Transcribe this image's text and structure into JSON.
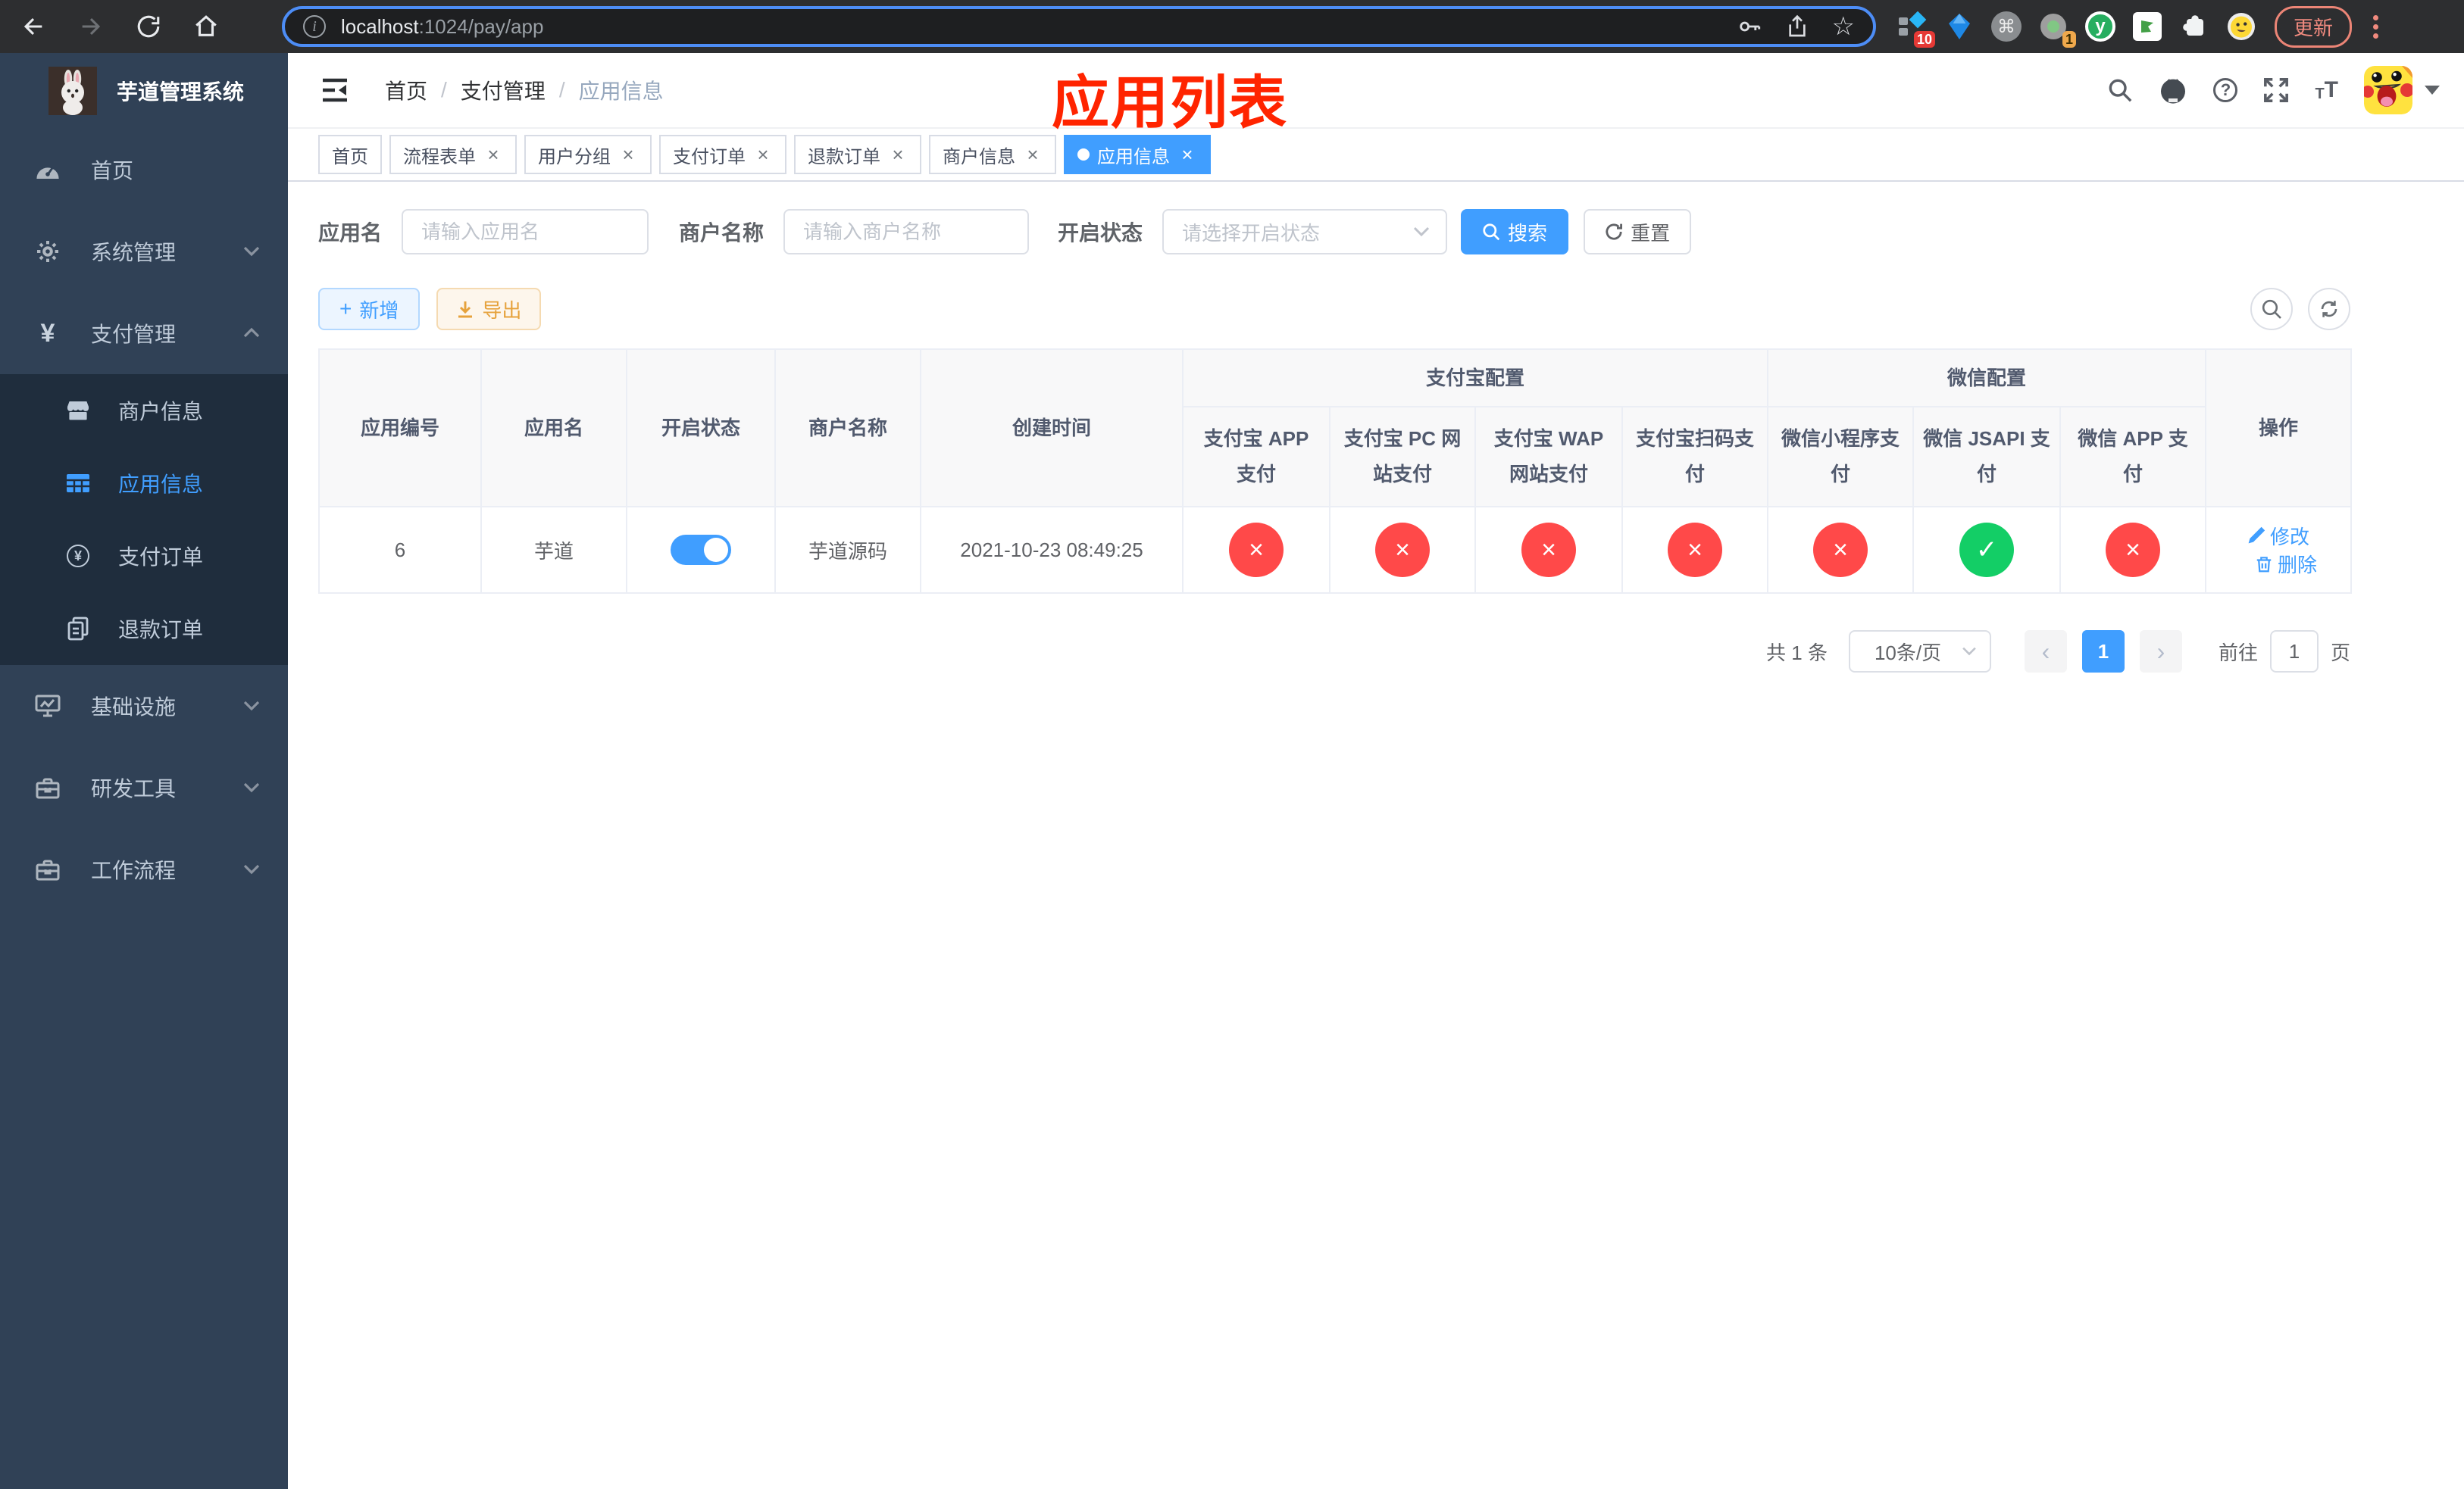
{
  "browser": {
    "url": {
      "host": "localhost",
      "path": ":1024/pay/app"
    },
    "update_label": "更新",
    "ext_badge_10": "10",
    "ext_badge_1": "1"
  },
  "glyphs": {
    "yen": "¥",
    "plus": "+",
    "star": "☆",
    "cmd": "⌘",
    "y_logo": "y",
    "question": "?",
    "info": "i",
    "prev": "‹",
    "next": "›",
    "check": "✓",
    "cross": "×",
    "t": "T"
  },
  "sidebar": {
    "logo_title": "芋道管理系统",
    "menu": [
      {
        "label": "首页"
      },
      {
        "label": "系统管理"
      },
      {
        "label": "支付管理"
      },
      {
        "label": "商户信息"
      },
      {
        "label": "应用信息"
      },
      {
        "label": "支付订单"
      },
      {
        "label": "退款订单"
      },
      {
        "label": "基础设施"
      },
      {
        "label": "研发工具"
      },
      {
        "label": "工作流程"
      }
    ]
  },
  "navbar": {
    "breadcrumb": [
      "首页",
      "支付管理",
      "应用信息"
    ]
  },
  "annotation": "应用列表",
  "tabs": [
    {
      "label": "首页"
    },
    {
      "label": "流程表单"
    },
    {
      "label": "用户分组"
    },
    {
      "label": "支付订单"
    },
    {
      "label": "退款订单"
    },
    {
      "label": "商户信息"
    },
    {
      "label": "应用信息"
    }
  ],
  "filters": {
    "app_name_label": "应用名",
    "app_name_placeholder": "请输入应用名",
    "merchant_label": "商户名称",
    "merchant_placeholder": "请输入商户名称",
    "status_label": "开启状态",
    "status_placeholder": "请选择开启状态",
    "search_label": "搜索",
    "reset_label": "重置"
  },
  "toolbar": {
    "add_label": "新增",
    "export_label": "导出"
  },
  "table": {
    "columns": {
      "app_id": "应用编号",
      "app_name": "应用名",
      "open_status": "开启状态",
      "merchant_name": "商户名称",
      "create_time": "创建时间",
      "alipay_group": "支付宝配置",
      "wechat_group": "微信配置",
      "actions": "操作",
      "sub": [
        "支付宝 APP 支付",
        "支付宝 PC 网站支付",
        "支付宝 WAP 网站支付",
        "支付宝扫码支付",
        "微信小程序支付",
        "微信 JSAPI 支付",
        "微信 APP 支付"
      ]
    },
    "rows": [
      {
        "app_id": "6",
        "app_name": "芋道",
        "open": true,
        "merchant_name": "芋道源码",
        "create_time": "2021-10-23 08:49:25",
        "pay_channels": [
          "disabled",
          "disabled",
          "disabled",
          "disabled",
          "disabled",
          "enabled",
          "disabled"
        ],
        "edit_label": "修改",
        "delete_label": "删除"
      }
    ]
  },
  "pagination": {
    "total_text": "共 1 条",
    "page_size": "10条/页",
    "current_page": "1",
    "goto_label": "前往",
    "goto_value": "1",
    "page_unit": "页"
  },
  "colors": {
    "accent": "#409eff",
    "success": "#13ce66",
    "danger": "#ff4949",
    "warning": "#e6a23c",
    "sidebar_bg": "#304156",
    "submenu_bg": "#1f2d3d",
    "annotation_red": "#ff2400"
  }
}
